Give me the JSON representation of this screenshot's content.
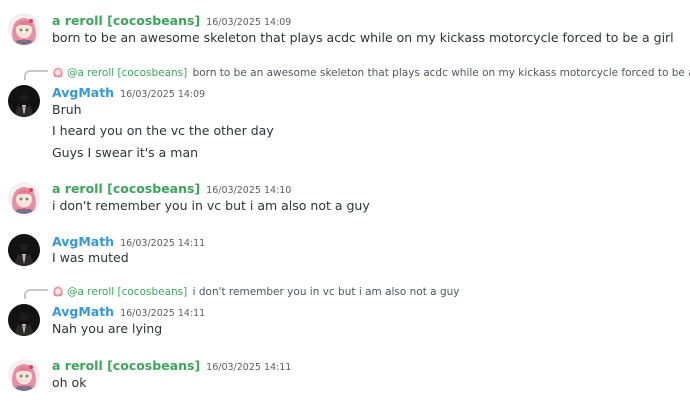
{
  "messages": [
    {
      "author": "a reroll [cocosbeans]",
      "timestamp": "16/03/2025 14:09",
      "lines": [
        "born to be an awesome skeleton that plays acdc while on my kickass motorcycle forced to be a girl"
      ]
    },
    {
      "reply_to": {
        "mention": "@a reroll [cocosbeans]",
        "text": "born to be an awesome skeleton that plays acdc while on my kickass motorcycle forced to be a girl"
      },
      "author": "AvgMath",
      "timestamp": "16/03/2025 14:09",
      "lines": [
        "Bruh",
        "I heard you on the vc the other day",
        "Guys I swear it's a man"
      ]
    },
    {
      "author": "a reroll [cocosbeans]",
      "timestamp": "16/03/2025 14:10",
      "lines": [
        "i don't remember you in vc but i am also not a guy"
      ]
    },
    {
      "author": "AvgMath",
      "timestamp": "16/03/2025 14:11",
      "lines": [
        "I was muted"
      ]
    },
    {
      "reply_to": {
        "mention": "@a reroll [cocosbeans]",
        "text": "i don't remember you in vc but i am also not a guy"
      },
      "author": "AvgMath",
      "timestamp": "16/03/2025 14:11",
      "lines": [
        "Nah you are lying"
      ]
    },
    {
      "author": "a reroll [cocosbeans]",
      "timestamp": "16/03/2025 14:11",
      "lines": [
        "oh ok"
      ]
    }
  ],
  "colors": {
    "reroll_name": "#3ba55c",
    "avgmath_name": "#3498db",
    "text": "#2e3338",
    "timestamp": "#5c5e66"
  },
  "icons": {
    "reroll_avatar": "anime-girl-pink-hair-avatar",
    "avgmath_avatar": "dark-suit-avatar"
  }
}
